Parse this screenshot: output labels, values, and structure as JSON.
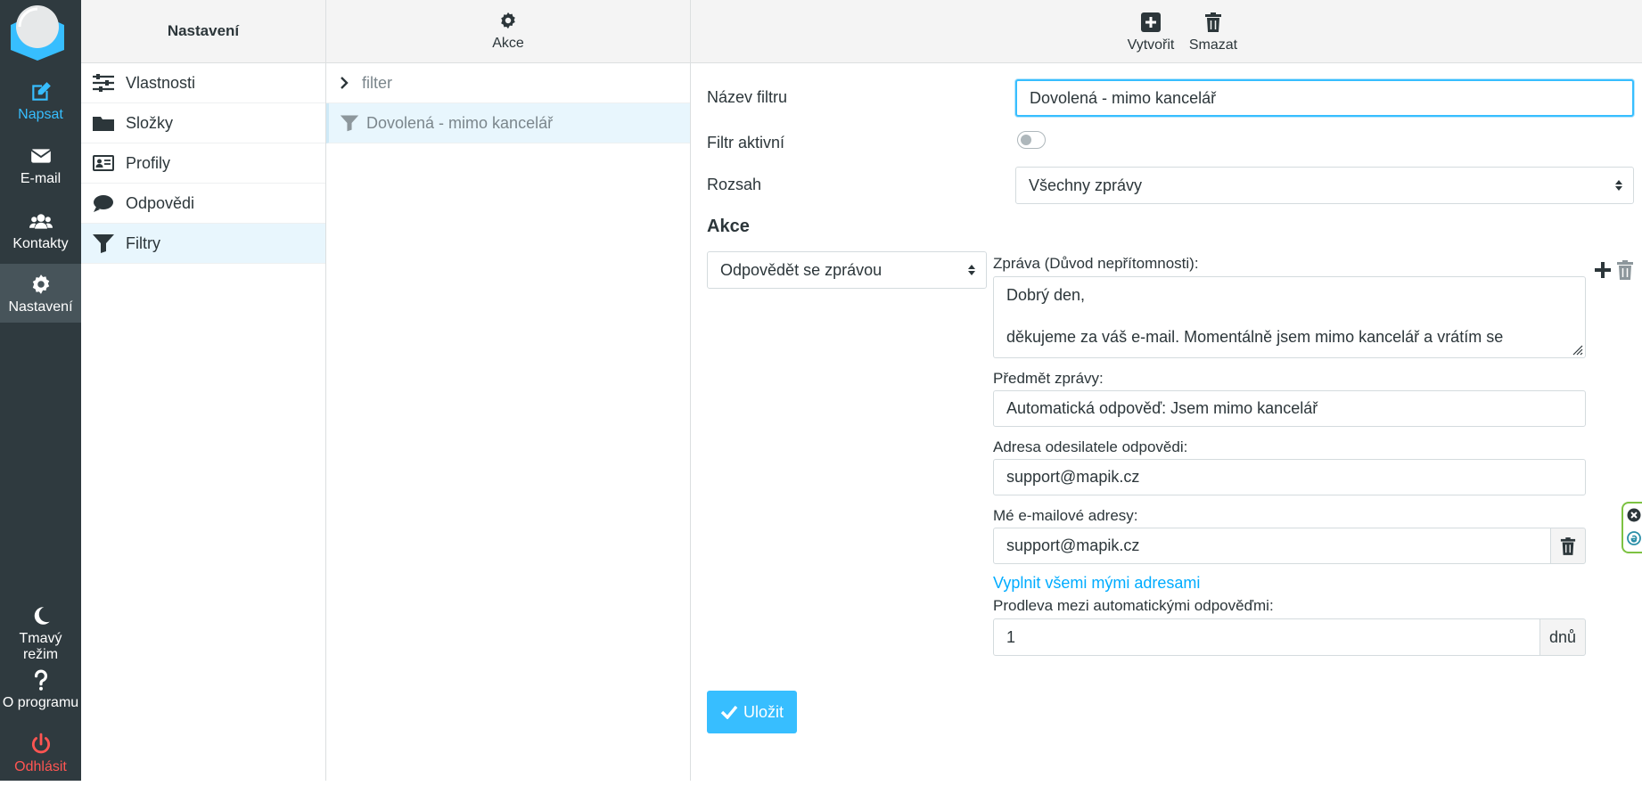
{
  "rail": {
    "items": [
      {
        "label": "Napsat",
        "icon": "compose-icon"
      },
      {
        "label": "E-mail",
        "icon": "envelope-icon"
      },
      {
        "label": "Kontakty",
        "icon": "contacts-icon"
      },
      {
        "label": "Nastavení",
        "icon": "gear-icon"
      }
    ],
    "bottom": [
      {
        "label": "Tmavý režim",
        "icon": "moon-icon"
      },
      {
        "label": "O programu",
        "icon": "question-icon"
      },
      {
        "label": "Odhlásit",
        "icon": "power-icon"
      }
    ]
  },
  "menu": {
    "title": "Nastavení",
    "items": [
      {
        "label": "Vlastnosti",
        "icon": "sliders-icon"
      },
      {
        "label": "Složky",
        "icon": "folder-icon"
      },
      {
        "label": "Profily",
        "icon": "id-card-icon"
      },
      {
        "label": "Odpovědi",
        "icon": "comment-icon"
      },
      {
        "label": "Filtry",
        "icon": "filter-icon"
      }
    ]
  },
  "list": {
    "toolbar_label": "Akce",
    "group": "filter",
    "selected_filter": "Dovolená - mimo kancelář"
  },
  "main": {
    "toolbar": {
      "create": "Vytvořit",
      "delete": "Smazat"
    },
    "filter_name_label": "Název filtru",
    "filter_name_value": "Dovolená - mimo kancelář",
    "active_label": "Filtr aktivní",
    "scope_label": "Rozsah",
    "scope_value": "Všechny zprávy",
    "actions_heading": "Akce",
    "action_select": "Odpovědět se zprávou",
    "message_label": "Zpráva (Důvod nepřítomnosti):",
    "message_line1": "Dobrý den,",
    "message_line2": "děkujeme za váš e-mail. Momentálně jsem mimo kancelář a vrátím se",
    "subject_label": "Předmět zprávy:",
    "subject_value": "Automatická odpověď: Jsem mimo kancelář",
    "sender_label": "Adresa odesilatele odpovědi:",
    "sender_value": "support@mapik.cz",
    "my_addresses_label": "Mé e-mailové adresy:",
    "my_addresses_value": "support@mapik.cz",
    "fill_link": "Vyplnit všemi mými adresami",
    "delay_label": "Prodleva mezi automatickými odpověďmi:",
    "delay_value": "1",
    "delay_unit": "dnů",
    "save_label": "Uložit"
  },
  "colors": {
    "accent": "#37beff",
    "rail_bg": "#2f3a3f",
    "logout": "#ff5552"
  }
}
